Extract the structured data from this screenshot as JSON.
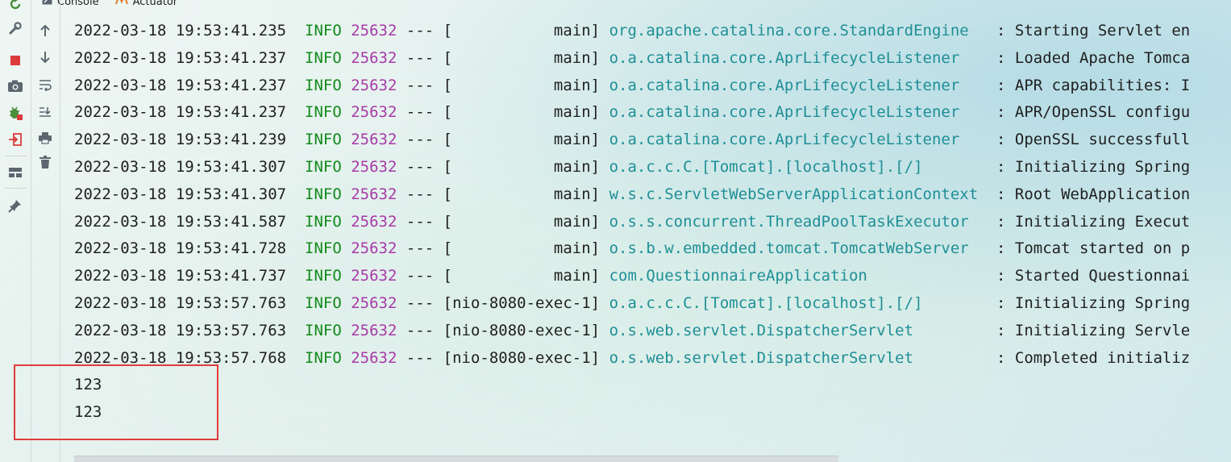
{
  "tabs": [
    {
      "label": "Console",
      "icon": "console-icon"
    },
    {
      "label": "Actuator",
      "icon": "actuator-icon"
    }
  ],
  "colors": {
    "info": "#128a1a",
    "pid": "#a83aa8",
    "logger": "#1f8f96",
    "highlight": "#e23b3b"
  },
  "log_lines": [
    {
      "ts": "2022-03-18 19:53:41.235",
      "level": "INFO",
      "pid": "25632",
      "sep": "---",
      "thread": "[           main]",
      "logger": "org.apache.catalina.core.StandardEngine  ",
      "msg": ": Starting Servlet en"
    },
    {
      "ts": "2022-03-18 19:53:41.237",
      "level": "INFO",
      "pid": "25632",
      "sep": "---",
      "thread": "[           main]",
      "logger": "o.a.catalina.core.AprLifecycleListener   ",
      "msg": ": Loaded Apache Tomca"
    },
    {
      "ts": "2022-03-18 19:53:41.237",
      "level": "INFO",
      "pid": "25632",
      "sep": "---",
      "thread": "[           main]",
      "logger": "o.a.catalina.core.AprLifecycleListener   ",
      "msg": ": APR capabilities: I"
    },
    {
      "ts": "2022-03-18 19:53:41.237",
      "level": "INFO",
      "pid": "25632",
      "sep": "---",
      "thread": "[           main]",
      "logger": "o.a.catalina.core.AprLifecycleListener   ",
      "msg": ": APR/OpenSSL configu"
    },
    {
      "ts": "2022-03-18 19:53:41.239",
      "level": "INFO",
      "pid": "25632",
      "sep": "---",
      "thread": "[           main]",
      "logger": "o.a.catalina.core.AprLifecycleListener   ",
      "msg": ": OpenSSL successfull"
    },
    {
      "ts": "2022-03-18 19:53:41.307",
      "level": "INFO",
      "pid": "25632",
      "sep": "---",
      "thread": "[           main]",
      "logger": "o.a.c.c.C.[Tomcat].[localhost].[/]       ",
      "msg": ": Initializing Spring"
    },
    {
      "ts": "2022-03-18 19:53:41.307",
      "level": "INFO",
      "pid": "25632",
      "sep": "---",
      "thread": "[           main]",
      "logger": "w.s.c.ServletWebServerApplicationContext ",
      "msg": ": Root WebApplication"
    },
    {
      "ts": "2022-03-18 19:53:41.587",
      "level": "INFO",
      "pid": "25632",
      "sep": "---",
      "thread": "[           main]",
      "logger": "o.s.s.concurrent.ThreadPoolTaskExecutor  ",
      "msg": ": Initializing Execut"
    },
    {
      "ts": "2022-03-18 19:53:41.728",
      "level": "INFO",
      "pid": "25632",
      "sep": "---",
      "thread": "[           main]",
      "logger": "o.s.b.w.embedded.tomcat.TomcatWebServer  ",
      "msg": ": Tomcat started on p"
    },
    {
      "ts": "2022-03-18 19:53:41.737",
      "level": "INFO",
      "pid": "25632",
      "sep": "---",
      "thread": "[           main]",
      "logger": "com.QuestionnaireApplication             ",
      "msg": ": Started Questionnai"
    },
    {
      "ts": "2022-03-18 19:53:57.763",
      "level": "INFO",
      "pid": "25632",
      "sep": "---",
      "thread": "[nio-8080-exec-1]",
      "logger": "o.a.c.c.C.[Tomcat].[localhost].[/]       ",
      "msg": ": Initializing Spring"
    },
    {
      "ts": "2022-03-18 19:53:57.763",
      "level": "INFO",
      "pid": "25632",
      "sep": "---",
      "thread": "[nio-8080-exec-1]",
      "logger": "o.s.web.servlet.DispatcherServlet        ",
      "msg": ": Initializing Servle"
    },
    {
      "ts": "2022-03-18 19:53:57.768",
      "level": "INFO",
      "pid": "25632",
      "sep": "---",
      "thread": "[nio-8080-exec-1]",
      "logger": "o.s.web.servlet.DispatcherServlet        ",
      "msg": ": Completed initializ"
    }
  ],
  "output_lines": [
    "123",
    "123"
  ]
}
